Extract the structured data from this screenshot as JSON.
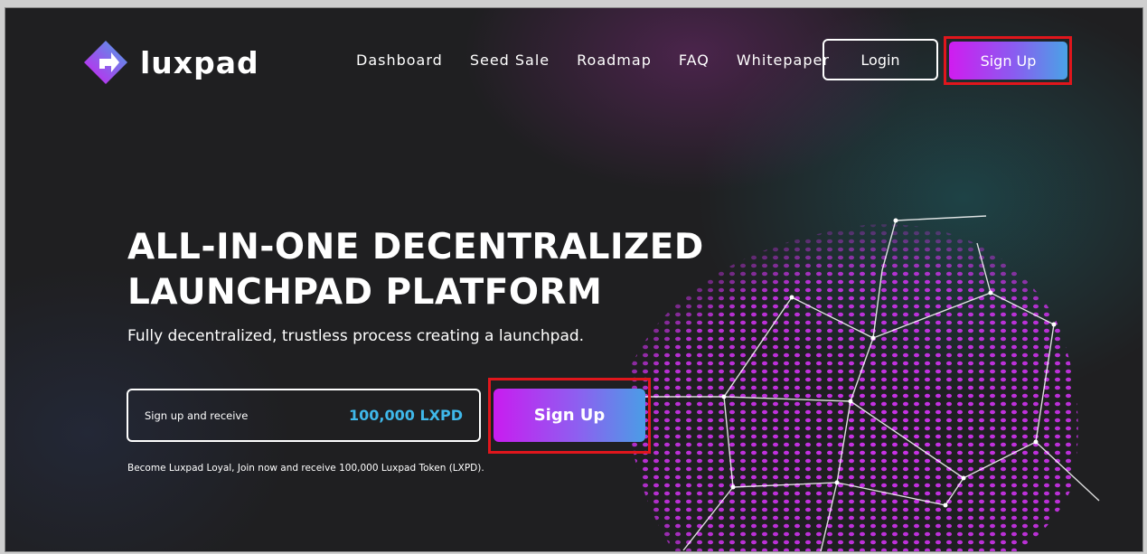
{
  "brand": {
    "name": "luxpad"
  },
  "nav": {
    "items": [
      {
        "label": "Dashboard"
      },
      {
        "label": "Seed Sale"
      },
      {
        "label": "Roadmap"
      },
      {
        "label": "FAQ"
      },
      {
        "label": "Whitepaper"
      }
    ],
    "login_label": "Login",
    "signup_label": "Sign Up"
  },
  "hero": {
    "title_line1": "ALL-IN-ONE DECENTRALIZED",
    "title_line2": "LAUNCHPAD PLATFORM",
    "subtitle": "Fully decentralized, trustless process creating a launchpad.",
    "promo_label": "Sign up and receive",
    "promo_amount": "100,000 LXPD",
    "signup_label": "Sign Up",
    "footnote": "Become Luxpad Loyal, Join now and receive 100,000 Luxpad Token (LXPD)."
  },
  "colors": {
    "background": "#1f1f21",
    "accent_start": "#d01cf0",
    "accent_end": "#4aa3e6",
    "amount": "#3fb8ea",
    "highlight": "#e0161c"
  }
}
